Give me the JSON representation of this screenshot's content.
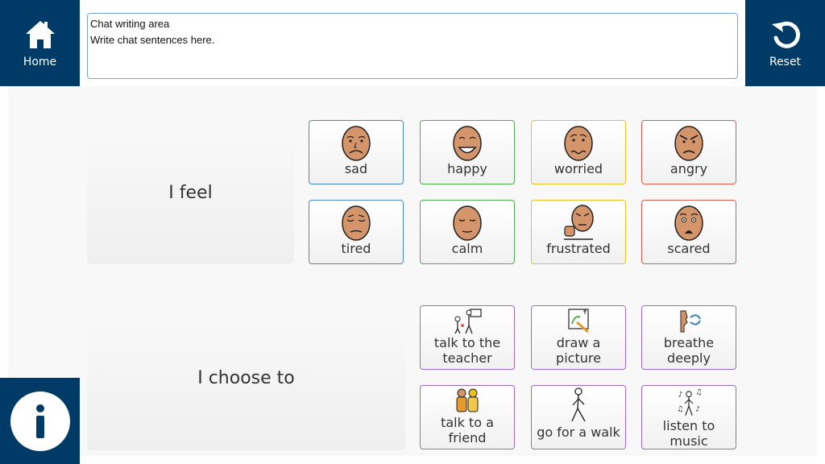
{
  "nav": {
    "home_label": "Home",
    "reset_label": "Reset"
  },
  "chat": {
    "title": "Chat writing area",
    "placeholder": "Write chat sentences here."
  },
  "feel": {
    "label": "I feel",
    "items": [
      {
        "label": "sad",
        "icon": "sad-face-icon"
      },
      {
        "label": "happy",
        "icon": "happy-face-icon"
      },
      {
        "label": "worried",
        "icon": "worried-face-icon"
      },
      {
        "label": "angry",
        "icon": "angry-face-icon"
      },
      {
        "label": "tired",
        "icon": "tired-face-icon"
      },
      {
        "label": "calm",
        "icon": "calm-face-icon"
      },
      {
        "label": "frustrated",
        "icon": "frustrated-face-icon"
      },
      {
        "label": "scared",
        "icon": "scared-face-icon"
      }
    ]
  },
  "choose": {
    "label": "I choose to",
    "items": [
      {
        "label": "talk to the teacher",
        "icon": "teacher-icon"
      },
      {
        "label": "draw a picture",
        "icon": "drawing-icon"
      },
      {
        "label": "breathe deeply",
        "icon": "breathing-icon"
      },
      {
        "label": "talk to a friend",
        "icon": "friends-icon"
      },
      {
        "label": "go for a walk",
        "icon": "walking-icon"
      },
      {
        "label": "listen to music",
        "icon": "music-icon"
      }
    ]
  },
  "colors": {
    "nav_bg": "#003a66",
    "feel_border_1": "#4a86c8",
    "feel_border_2": "#4caf50",
    "feel_border_3": "#e8c21c",
    "feel_border_4": "#e05a50",
    "choose_border": "#9b6ad2",
    "face_skin": "#d4956a"
  }
}
